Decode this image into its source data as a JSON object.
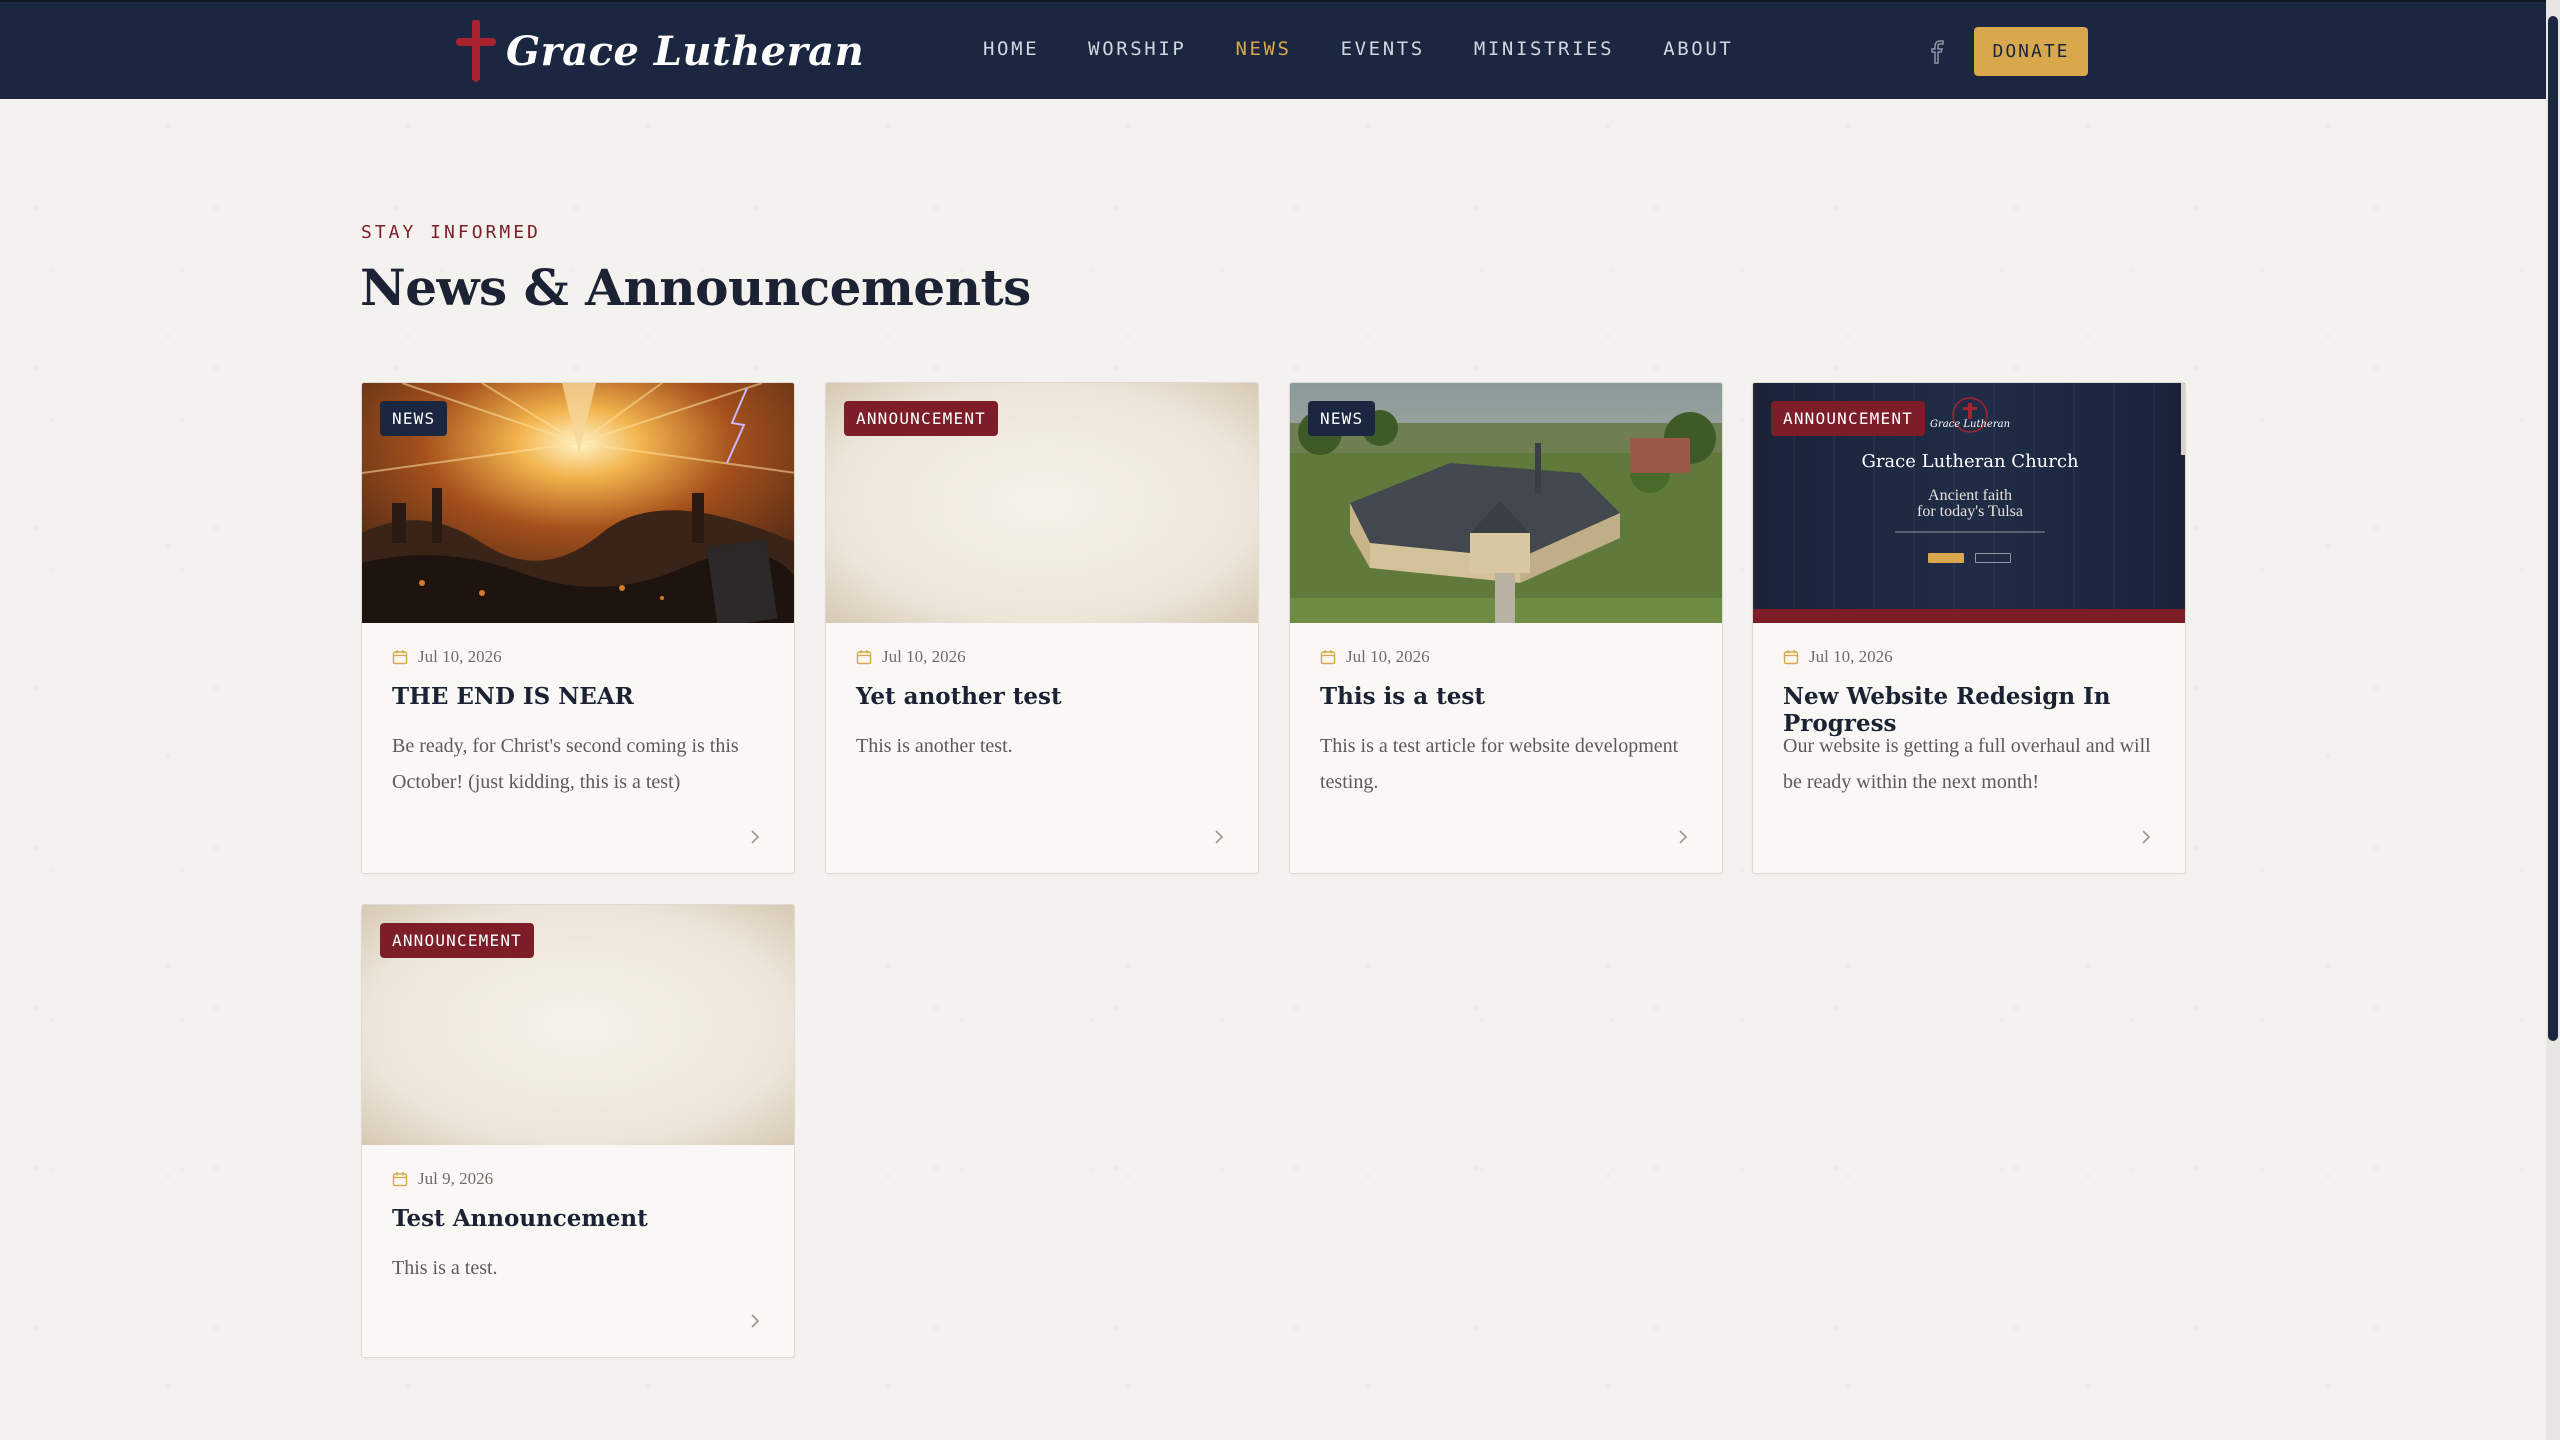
{
  "nav": {
    "brand": "Grace Lutheran",
    "links": [
      "HOME",
      "WORSHIP",
      "NEWS",
      "EVENTS",
      "MINISTRIES",
      "ABOUT"
    ],
    "active_link": "NEWS",
    "social_icon": "facebook-icon",
    "donate_label": "DONATE"
  },
  "header": {
    "eyebrow": "STAY INFORMED",
    "title": "News & Announcements"
  },
  "cards": [
    {
      "tag": "NEWS",
      "date": "Jul 10, 2026",
      "title": "THE END IS NEAR",
      "excerpt": "Be ready, for Christ's second coming is this October! (just kidding, this is a test)",
      "image": "apocalypse-illustration"
    },
    {
      "tag": "ANNOUNCEMENT",
      "date": "Jul 10, 2026",
      "title": "Yet another test",
      "excerpt": "This is another test.",
      "image": "parchment-placeholder"
    },
    {
      "tag": "NEWS",
      "date": "Jul 10, 2026",
      "title": "This is a test",
      "excerpt": "This is a test article for website development testing.",
      "image": "church-aerial-photo"
    },
    {
      "tag": "ANNOUNCEMENT",
      "date": "Jul 10, 2026",
      "title": "New Website Redesign In Progress",
      "excerpt": "Our website is getting a full overhaul and will be ready within the next month!",
      "image": "website-screenshot",
      "image_text": {
        "brand": "Grace Lutheran",
        "heading": "Grace Lutheran Church",
        "tagline_1": "Ancient faith",
        "tagline_2": "for today's Tulsa"
      }
    },
    {
      "tag": "ANNOUNCEMENT",
      "date": "Jul 9, 2026",
      "title": "Test Announcement",
      "excerpt": "This is a test.",
      "image": "parchment-placeholder"
    }
  ],
  "colors": {
    "navy": "#1b2740",
    "gold": "#d9a84c",
    "burgundy": "#7c1d27",
    "background": "#f4f2ee"
  }
}
